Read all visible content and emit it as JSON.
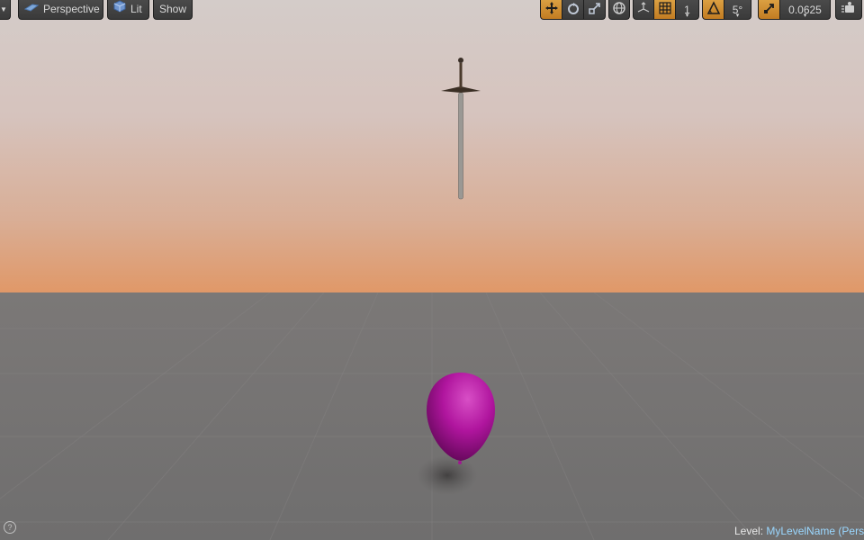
{
  "toolbar": {
    "left": {
      "dropdown_icon": "chevron-down-icon",
      "perspective_label": "Perspective",
      "perspective_icon": "perspective-icon",
      "lit_label": "Lit",
      "lit_icon": "cube-icon",
      "show_label": "Show"
    },
    "right": {
      "translate_icon": "translate-icon",
      "rotate_icon": "rotate-icon",
      "scale_icon": "scale-icon",
      "world_icon": "globe-icon",
      "surface_snap_icon": "surface-snap-icon",
      "grid_snap_icon": "grid-icon",
      "grid_snap_value": "1",
      "rotation_snap_icon": "angle-icon",
      "rotation_snap_value": "5°",
      "scale_snap_icon": "scale-snap-icon",
      "scale_snap_value": "0.0625",
      "camera_speed_icon": "camera-speed-icon"
    }
  },
  "status": {
    "level_label": "Level:",
    "level_name": "MyLevelName (Pers"
  },
  "help_icon": "help-icon",
  "help_glyph": "?",
  "colors": {
    "active_orange": "#c9822a",
    "toolbar_gray": "#3f3f3f",
    "balloon_magenta": "#b0159e",
    "level_name_blue": "#9ad7ff"
  }
}
